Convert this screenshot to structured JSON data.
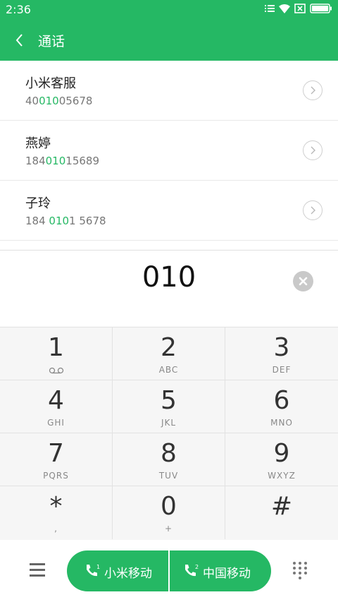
{
  "status_bar": {
    "time": "2:36"
  },
  "header": {
    "title": "通话"
  },
  "contacts": [
    {
      "name": "小米客服",
      "number_pre": "40",
      "number_match": "010",
      "number_post": "05678"
    },
    {
      "name": "燕婷",
      "number_pre": "184",
      "number_match": "010",
      "number_post": "15689"
    },
    {
      "name": "子玲",
      "number_pre": "184 ",
      "number_match": "010",
      "number_post": "1 5678"
    }
  ],
  "dial_input": {
    "value": "010"
  },
  "keypad": {
    "keys": [
      {
        "digit": "1",
        "sub": ""
      },
      {
        "digit": "2",
        "sub": "ABC"
      },
      {
        "digit": "3",
        "sub": "DEF"
      },
      {
        "digit": "4",
        "sub": "GHI"
      },
      {
        "digit": "5",
        "sub": "JKL"
      },
      {
        "digit": "6",
        "sub": "MNO"
      },
      {
        "digit": "7",
        "sub": "PQRS"
      },
      {
        "digit": "8",
        "sub": "TUV"
      },
      {
        "digit": "9",
        "sub": "WXYZ"
      },
      {
        "digit": "*",
        "sub": ","
      },
      {
        "digit": "0",
        "sub": "+"
      },
      {
        "digit": "#",
        "sub": ""
      }
    ]
  },
  "call_buttons": {
    "sim1": {
      "label": "小米移动",
      "sim": "1"
    },
    "sim2": {
      "label": "中国移动",
      "sim": "2"
    }
  },
  "colors": {
    "accent": "#25b864"
  },
  "icons": {
    "back": "chevron-left-icon",
    "voicemail": "voicemail-icon",
    "clear": "clear-icon",
    "menu": "menu-icon",
    "keypad": "dialpad-icon",
    "call": "phone-icon"
  }
}
